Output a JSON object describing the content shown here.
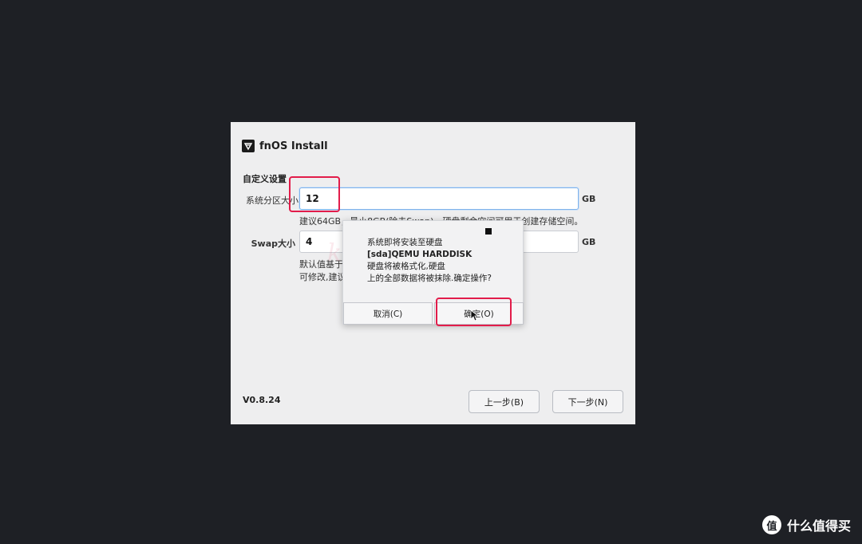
{
  "window": {
    "title": "fnOS Install",
    "logo_icon": "fnos-logo-icon"
  },
  "form": {
    "section_title": "自定义设置",
    "system_partition": {
      "label": "系统分区大小",
      "value": "12",
      "unit": "GB",
      "hint": "建议64GB，最小8GB(除去Swap)，硬盘剩余空间可用于创建存储空间。"
    },
    "swap": {
      "label": "Swap大小",
      "value": "4",
      "unit": "GB",
      "hint_line1": "默认值基于",
      "hint_line2": "可修改,建议"
    }
  },
  "footer": {
    "version": "V0.8.24",
    "prev_label": "上一步(B)",
    "next_label": "下一步(N)"
  },
  "dialog": {
    "line1": "系统即将安装至硬盘",
    "line2": "[sda]QEMU HARDDISK",
    "line3": "硬盘将被格式化,硬盘",
    "line4": "上的全部数据将被抹除.确定操作?",
    "cancel_label": "取消(C)",
    "ok_label": "确定(O)"
  },
  "watermark": "ko",
  "brand": {
    "logo_text": "值",
    "name": "什么值得买"
  },
  "colors": {
    "background": "#1e2025",
    "annotation": "#e21c4a",
    "focus_border": "#7fb2ea"
  }
}
